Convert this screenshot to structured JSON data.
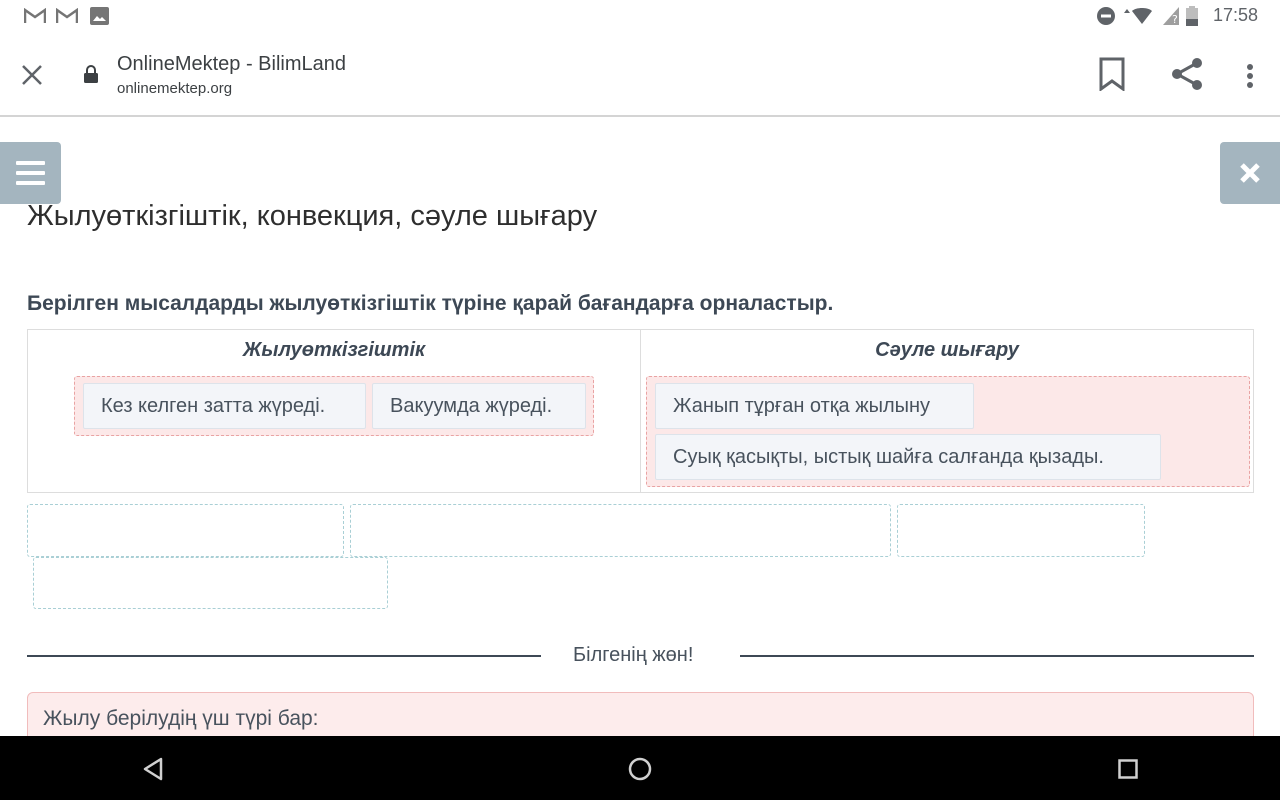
{
  "status_bar": {
    "time": "17:58",
    "left_icons": [
      "gmail-icon",
      "gmail-icon",
      "photo-icon"
    ],
    "right_icons": [
      "dnd-icon",
      "wifi-icon",
      "no-signal-icon",
      "battery-icon"
    ]
  },
  "browser": {
    "title": "OnlineMektep - BilimLand",
    "url": "onlinemektep.org",
    "icons": [
      "close-icon",
      "lock-icon",
      "bookmark-icon",
      "share-icon",
      "more-icon"
    ]
  },
  "page": {
    "title": "Жылуөткізгіштік, конвекция, сәуле шығару",
    "instruction": "Берілген мысалдарды жылуөткізгіштік түріне қарай бағандарға орналастыр.",
    "columns": [
      {
        "heading": "Жылуөткізгіштік",
        "items": [
          "Кез келген затта жүреді.",
          "Вакуумда жүреді."
        ]
      },
      {
        "heading": "Сәуле шығару",
        "items": [
          "Жанып тұрған отқа жылыну",
          "Суық қасықты, ыстық шайға салғанда қызады."
        ]
      }
    ],
    "empty_slot_count": 4,
    "divider_label": "Білгенің жөн!",
    "info_text": "Жылу берілудің үш түрі бар:"
  },
  "colors": {
    "accent_button": "#a4b5bf",
    "dropzone_fill": "#fce8e8",
    "text_dark": "#3d4855"
  }
}
